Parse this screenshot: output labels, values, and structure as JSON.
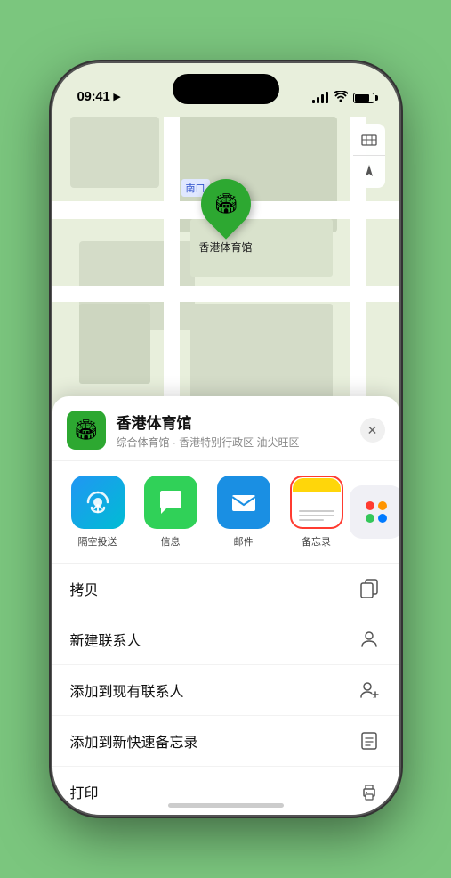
{
  "status_bar": {
    "time": "09:41",
    "location_arrow": "▶"
  },
  "map": {
    "label_south_entrance": "南口",
    "venue_name_pin": "香港体育馆",
    "controls": {
      "map_type_icon": "🗺",
      "location_icon": "➤"
    }
  },
  "venue_info": {
    "name": "香港体育馆",
    "subtitle": "综合体育馆 · 香港特别行政区 油尖旺区",
    "emoji": "🏟"
  },
  "share_icons": [
    {
      "id": "airdrop",
      "label": "隔空投送",
      "type": "airdrop"
    },
    {
      "id": "messages",
      "label": "信息",
      "type": "messages"
    },
    {
      "id": "mail",
      "label": "邮件",
      "type": "mail"
    },
    {
      "id": "notes",
      "label": "备忘录",
      "type": "notes"
    }
  ],
  "more_dots": {
    "colors": [
      "#ff3b30",
      "#ff9500",
      "#34c759",
      "#007aff",
      "#5856d6",
      "#ff2d55"
    ]
  },
  "actions": [
    {
      "label": "拷贝",
      "icon": "copy"
    },
    {
      "label": "新建联系人",
      "icon": "person"
    },
    {
      "label": "添加到现有联系人",
      "icon": "person-add"
    },
    {
      "label": "添加到新快速备忘录",
      "icon": "note"
    },
    {
      "label": "打印",
      "icon": "printer"
    }
  ]
}
